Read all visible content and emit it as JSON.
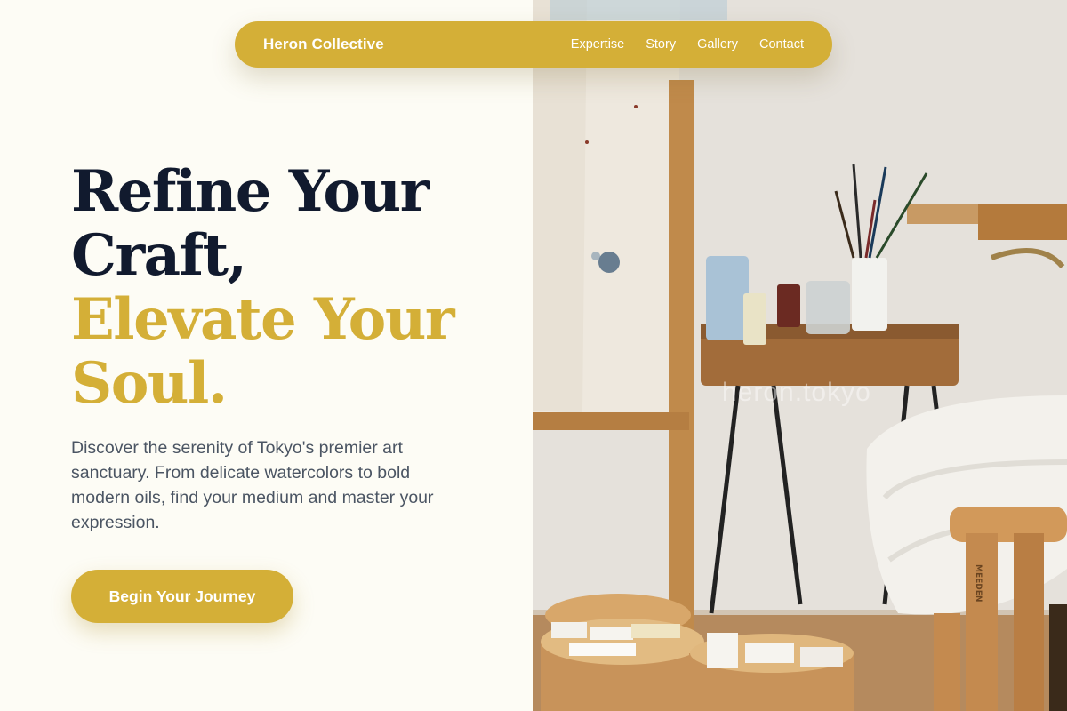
{
  "nav": {
    "brand": "Heron Collective",
    "links": [
      "Expertise",
      "Story",
      "Gallery",
      "Contact"
    ]
  },
  "hero": {
    "title_dark": [
      "Refine Your",
      "Craft,"
    ],
    "title_gold": [
      "Elevate Your",
      "Soul."
    ],
    "subtitle": "Discover the serenity of Tokyo's premier art sanctuary. From delicate watercolors to bold modern oils, find your medium and master your expression.",
    "cta": "Begin Your Journey"
  },
  "photo": {
    "watermark": "heron.tokyo",
    "stool_brand": "MEEDEN"
  },
  "colors": {
    "accent": "#d4af37",
    "heading_dark": "#111a2e",
    "body_text": "#4b5563",
    "background": "#fdfcf5"
  }
}
